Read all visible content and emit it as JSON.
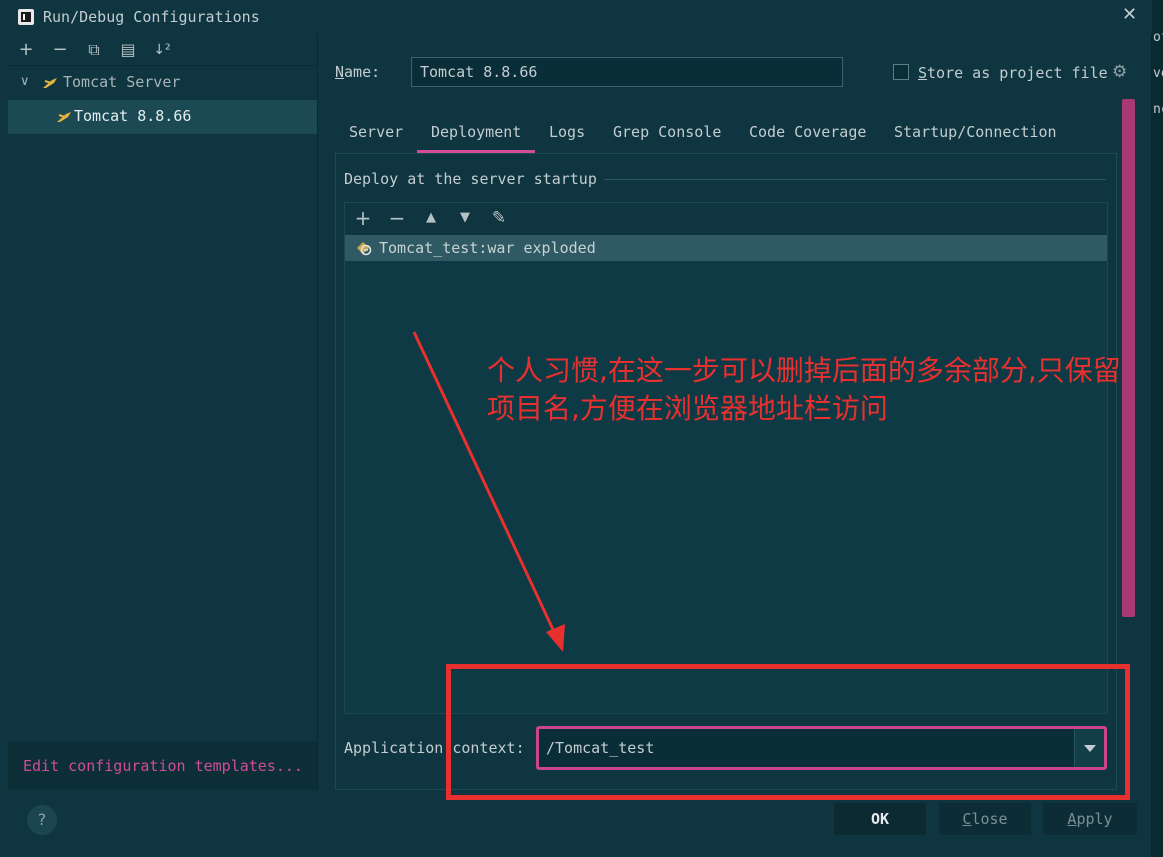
{
  "window": {
    "title": "Run/Debug Configurations",
    "close_glyph": "✕"
  },
  "left_toolbar": {
    "add": "+",
    "remove": "−",
    "copy": "⧉",
    "folder": "▤",
    "sort": "↓²"
  },
  "tree": {
    "group_label": "Tomcat Server",
    "item_label": "Tomcat 8.8.66"
  },
  "edit_templates_label": "Edit configuration templates...",
  "name_label_prefix": "N",
  "name_label_rest": "ame:",
  "name_value": "Tomcat 8.8.66",
  "store_label_prefix": "S",
  "store_label_rest": "tore as project file",
  "tabs": [
    "Server",
    "Deployment",
    "Logs",
    "Grep Console",
    "Code Coverage",
    "Startup/Connection"
  ],
  "active_tab": "Deployment",
  "section_title": "Deploy at the server startup",
  "deploy_toolbar": {
    "add": "+",
    "remove": "−",
    "up": "▲",
    "down": "▼",
    "edit": "✎"
  },
  "deploy_items": [
    "Tomcat_test:war exploded"
  ],
  "context_label": "Application context:",
  "context_value": "/Tomcat_test",
  "annotation": {
    "text": "个人习惯,在这一步可以删掉后面的多余部分,只保留项目名,方便在浏览器地址栏访问"
  },
  "buttons": {
    "ok": "OK",
    "close_prefix": "C",
    "close_rest": "lose",
    "apply_prefix": "A",
    "apply_rest": "pply",
    "help": "?"
  },
  "right_strip": [
    "of",
    "ve",
    "nc"
  ],
  "colors": {
    "accent": "#d14c99",
    "annotation": "#e8302f",
    "background": "#0f3640"
  }
}
